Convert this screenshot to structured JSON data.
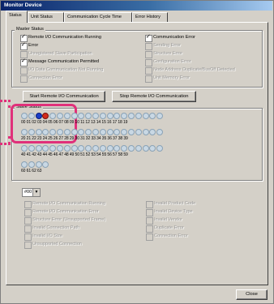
{
  "window": {
    "title": "Monitor Device"
  },
  "tabs": [
    "Status",
    "Unit Status",
    "Communication Cycle Time",
    "Error History"
  ],
  "master_status": {
    "label": "Master Status",
    "left": [
      {
        "label": "Remote I/O Communication Running",
        "checked": true,
        "enabled": true
      },
      {
        "label": "Error",
        "checked": true,
        "enabled": true
      },
      {
        "label": "Unregistered Slave Participation",
        "checked": false,
        "enabled": false
      },
      {
        "label": "Message Communication Permitted",
        "checked": true,
        "enabled": true
      },
      {
        "label": "I/O Data Communication Not Running",
        "checked": false,
        "enabled": false
      },
      {
        "label": "Connection Error",
        "checked": false,
        "enabled": false
      }
    ],
    "right": [
      {
        "label": "Communication Error",
        "checked": true,
        "enabled": true
      },
      {
        "label": "Sending Error",
        "checked": false,
        "enabled": false
      },
      {
        "label": "Structure Error",
        "checked": false,
        "enabled": false
      },
      {
        "label": "Configuration Error",
        "checked": false,
        "enabled": false
      },
      {
        "label": "Node Address Duplicate/BusOff Detected",
        "checked": false,
        "enabled": false
      },
      {
        "label": "Unit Memory Error",
        "checked": false,
        "enabled": false
      }
    ]
  },
  "buttons": {
    "start": "Start Remote I/O Communication",
    "stop": "Stop Remote I/O Communication",
    "close": "Close"
  },
  "slave_status": {
    "label": "Slave Status",
    "rows": [
      {
        "numbers": "00 01 02 03 04 05 06 07 08 09 10 11 12 13 14 15 16 17 18 19",
        "colors": [
          "grey",
          "grey",
          "blue",
          "red",
          "grey",
          "grey",
          "grey",
          "grey",
          "grey",
          "grey",
          "grey",
          "grey",
          "grey",
          "grey",
          "grey",
          "grey",
          "grey",
          "grey",
          "grey",
          "grey"
        ]
      },
      {
        "numbers": "20 21 22 23 24 25 26 27 28 29 30 31 32 33 34 35 36 37 38 39",
        "colors": [
          "grey",
          "grey",
          "grey",
          "grey",
          "grey",
          "grey",
          "grey",
          "grey",
          "grey",
          "grey",
          "grey",
          "grey",
          "grey",
          "grey",
          "grey",
          "grey",
          "grey",
          "grey",
          "grey",
          "grey"
        ]
      },
      {
        "numbers": "40 41 42 43 44 45 46 47 48 49 50 51 52 53 54 55 56 57 58 59",
        "colors": [
          "grey",
          "grey",
          "grey",
          "grey",
          "grey",
          "grey",
          "grey",
          "grey",
          "grey",
          "grey",
          "grey",
          "grey",
          "grey",
          "grey",
          "grey",
          "grey",
          "grey",
          "grey",
          "grey",
          "grey"
        ]
      },
      {
        "numbers": "60 61 62 63",
        "colors": [
          "grey",
          "grey",
          "grey",
          "grey"
        ]
      }
    ]
  },
  "node_select": {
    "value": "#00"
  },
  "detail_status": {
    "left": [
      "Remote I/O Communication Running",
      "Remote I/O Communication Error",
      "Structure Error (Unsupported Frame)",
      "Invalid Connection Path",
      "Invalid I/O Size",
      "Unsupported Connection"
    ],
    "right": [
      "Invalid Product Code",
      "Invalid Device Type",
      "Invalid Vendor",
      "Duplicate Error",
      "Connection Error"
    ]
  },
  "colors": {
    "highlight": "#e0307a",
    "slave_ok": "#c9d8e4",
    "slave_blue": "#1a3dc8",
    "slave_red": "#d42a1a"
  }
}
